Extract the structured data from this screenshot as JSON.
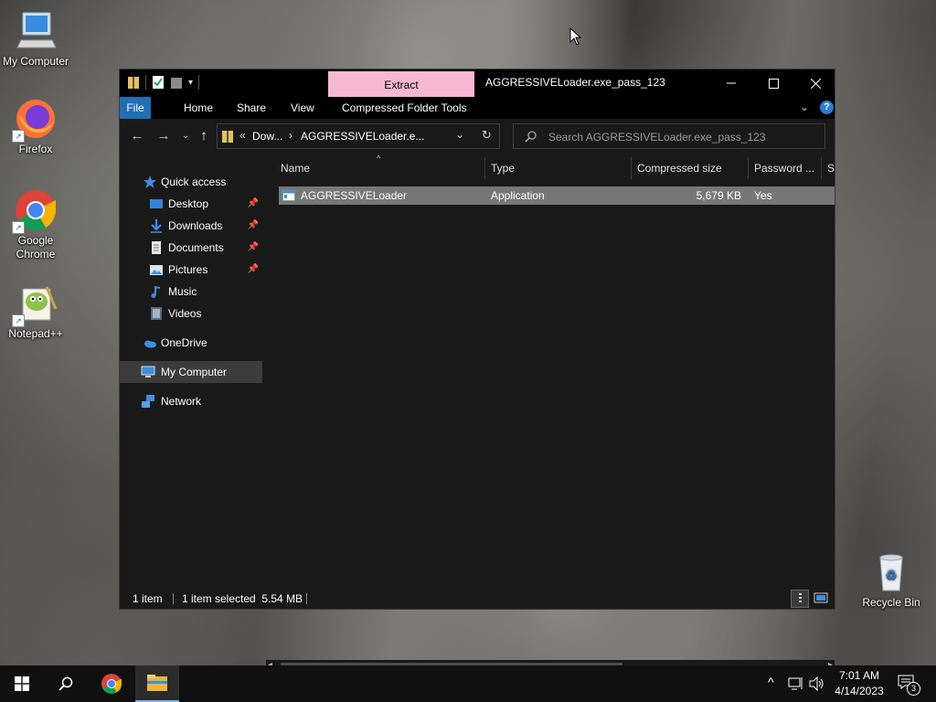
{
  "desktop": {
    "icons": [
      {
        "label": "My Computer"
      },
      {
        "label": "Firefox"
      },
      {
        "label": "Google Chrome"
      },
      {
        "label": "Notepad++"
      },
      {
        "label": "Recycle Bin"
      }
    ]
  },
  "window": {
    "extract_tab": "Extract",
    "title": "AGGRESSIVELoader.exe_pass_123",
    "ribbon_tabs": [
      "File",
      "Home",
      "Share",
      "View",
      "Compressed Folder Tools"
    ],
    "address": {
      "overflow": "«",
      "crumbs": [
        "Dow...",
        "AGGRESSIVELoader.e..."
      ]
    },
    "search": {
      "placeholder": "Search AGGRESSIVELoader.exe_pass_123"
    },
    "nav": {
      "quick_access": "Quick access",
      "items": [
        {
          "label": "Desktop",
          "icon": "desktop-icon",
          "pinned": true
        },
        {
          "label": "Downloads",
          "icon": "downloads-icon",
          "pinned": true
        },
        {
          "label": "Documents",
          "icon": "documents-icon",
          "pinned": true
        },
        {
          "label": "Pictures",
          "icon": "pictures-icon",
          "pinned": true
        },
        {
          "label": "Music",
          "icon": "music-icon",
          "pinned": false
        },
        {
          "label": "Videos",
          "icon": "videos-icon",
          "pinned": false
        }
      ],
      "onedrive": "OneDrive",
      "my_computer": "My Computer",
      "network": "Network"
    },
    "columns": [
      "Name",
      "Type",
      "Compressed size",
      "Password ...",
      "Si"
    ],
    "files": [
      {
        "name": "AGGRESSIVELoader",
        "type": "Application",
        "compressed_size": "5,679 KB",
        "password": "Yes"
      }
    ],
    "status": {
      "count": "1 item",
      "selection": "1 item selected  5.54 MB"
    }
  },
  "taskbar": {
    "time": "7:01 AM",
    "date": "4/14/2023",
    "notification_count": "3"
  }
}
